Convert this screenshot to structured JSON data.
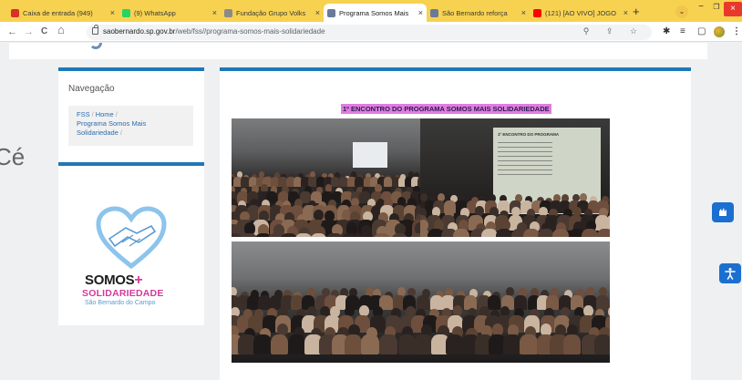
{
  "browser": {
    "tabs": [
      {
        "title": "Caixa de entrada (949)",
        "icon": "gmail-icon",
        "color": "#d93025",
        "active": false
      },
      {
        "title": "(9) WhatsApp",
        "icon": "whatsapp-icon",
        "color": "#25d366",
        "active": false
      },
      {
        "title": "Fundação Grupo Volks",
        "icon": "site-icon",
        "color": "#8a8a8a",
        "active": false
      },
      {
        "title": "Programa Somos Mais",
        "icon": "saobernardo-icon",
        "color": "#6b7a99",
        "active": true
      },
      {
        "title": "São Bernardo reforça",
        "icon": "saobernardo-icon",
        "color": "#6b7a99",
        "active": false
      },
      {
        "title": "(121) [AO VIVO] JOGO",
        "icon": "youtube-icon",
        "color": "#ff0000",
        "active": false
      }
    ],
    "url_domain": "saobernardo.sp.gov.br",
    "url_path": "/web/fss//programa-somos-mais-solidariedade",
    "new_tab": "+",
    "tab_search": "⌄",
    "window": {
      "minimize": "−",
      "maximize": "❐",
      "close": "×"
    },
    "nav": {
      "back": "←",
      "forward": "→",
      "reload": "C",
      "home": "⌂"
    },
    "omni_icons": "⚲ ⇪ ☆",
    "extensions": [
      "✱",
      "≡",
      "▢"
    ],
    "menu": "⋮"
  },
  "sidebar": {
    "title": "Navegação",
    "breadcrumb": {
      "items": [
        "FSS",
        "Home",
        "Programa Somos Mais Solidariedade"
      ],
      "separator": "/"
    }
  },
  "logo": {
    "line1": "SOMOS",
    "plus": "+",
    "line2": "SOLIDARIEDADE",
    "line3": "São Bernardo do Campo",
    "colors": {
      "blue": "#5a9ad2",
      "pink": "#d43a9a"
    }
  },
  "main": {
    "heading": "1º ENCONTRO DO PROGRAMA SOMOS MAIS SOLIDARIEDADE",
    "heading_bg": "#e07de0",
    "photos": [
      {
        "description_icon": "photo-audience-icon"
      },
      {
        "slide_title": "1º ENCONTRO DO PROGRAMA",
        "description_icon": "photo-presentation-icon"
      },
      {
        "description_icon": "photo-group-icon"
      }
    ]
  },
  "widgets": {
    "vlibras_icon": "vlibras-icon",
    "accessibility_icon": "accessibility-icon"
  },
  "fragment_text": "Cé"
}
